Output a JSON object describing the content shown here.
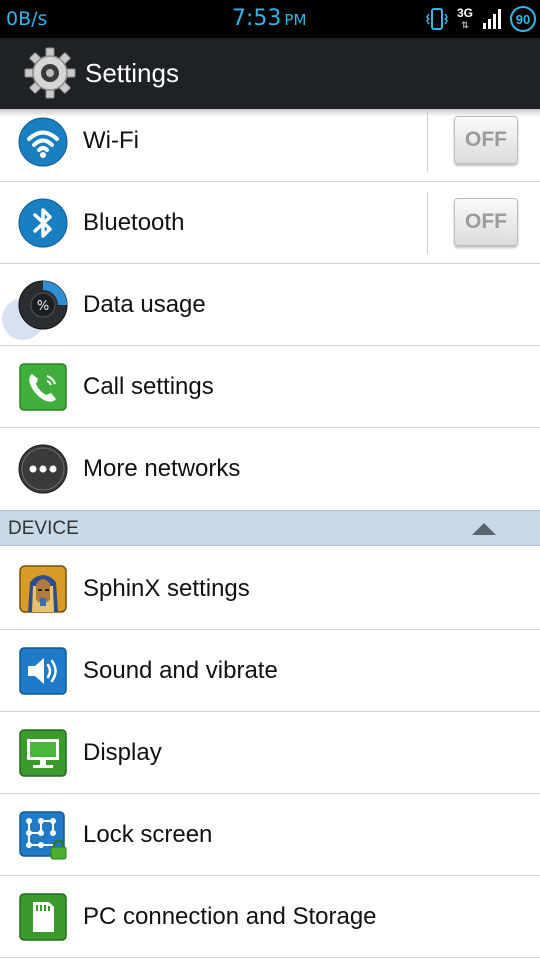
{
  "status_bar": {
    "data_rate": "0B/s",
    "time": "7:53",
    "ampm": "PM",
    "network_type": "3G",
    "battery_level": "90",
    "accent_color": "#33b5e5"
  },
  "action_bar": {
    "title": "Settings",
    "icon": "settings-gear-icon"
  },
  "wireless": {
    "items": [
      {
        "label": "Wi-Fi",
        "icon": "wifi-icon",
        "toggle": "OFF"
      },
      {
        "label": "Bluetooth",
        "icon": "bluetooth-icon",
        "toggle": "OFF"
      },
      {
        "label": "Data usage",
        "icon": "data-usage-icon"
      },
      {
        "label": "Call settings",
        "icon": "phone-icon"
      },
      {
        "label": "More networks",
        "icon": "more-dots-icon"
      }
    ]
  },
  "device_section": {
    "title": "DEVICE",
    "items": [
      {
        "label": "SphinX settings",
        "icon": "sphinx-icon"
      },
      {
        "label": "Sound and vibrate",
        "icon": "speaker-icon"
      },
      {
        "label": "Display",
        "icon": "monitor-icon"
      },
      {
        "label": "Lock screen",
        "icon": "lock-pattern-icon"
      },
      {
        "label": "PC connection and Storage",
        "icon": "sd-card-icon"
      }
    ]
  }
}
